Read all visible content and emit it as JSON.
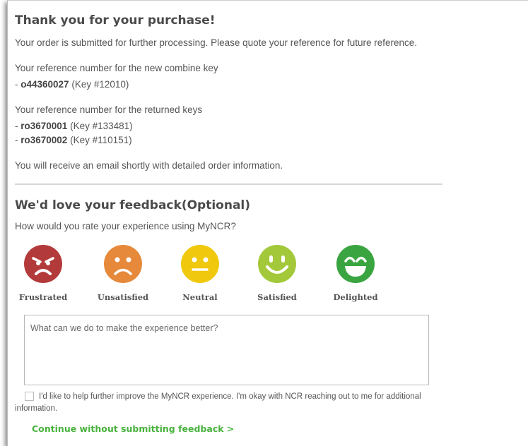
{
  "purchase": {
    "title": "Thank you for your purchase!",
    "message": "Your order is submitted for further processing. Please quote your reference for future reference.",
    "combine_key_heading": "Your reference number for the new combine key",
    "combine_key": {
      "ref": "o44360027",
      "key": "(Key #12010)"
    },
    "returned_keys_heading": "Your reference number for the returned keys",
    "returned_keys": [
      {
        "ref": "ro3670001",
        "key": "(Key #133481)"
      },
      {
        "ref": "ro3670002",
        "key": "(Key #110151)"
      }
    ],
    "email_note": "You will receive an email shortly with detailed order information."
  },
  "feedback": {
    "title": "We'd love your feedback(Optional)",
    "question": "How would you rate your experience using MyNCR?",
    "ratings": [
      {
        "label": "Frustrated",
        "icon": "frustrated-face-icon",
        "color": "#b33a3a"
      },
      {
        "label": "Unsatisfied",
        "icon": "unsatisfied-face-icon",
        "color": "#e6893a"
      },
      {
        "label": "Neutral",
        "icon": "neutral-face-icon",
        "color": "#f0c80e"
      },
      {
        "label": "Satisfied",
        "icon": "satisfied-face-icon",
        "color": "#a3c83a"
      },
      {
        "label": "Delighted",
        "icon": "delighted-face-icon",
        "color": "#3aa540"
      }
    ],
    "comment_placeholder": "What can we do to make the experience better?",
    "contact_consent": "I'd like to help further improve the MyNCR experience. I'm okay with NCR reaching out to me for additional information.",
    "continue_link": "Continue without submitting feedback >",
    "accent_color": "#48b23d"
  }
}
